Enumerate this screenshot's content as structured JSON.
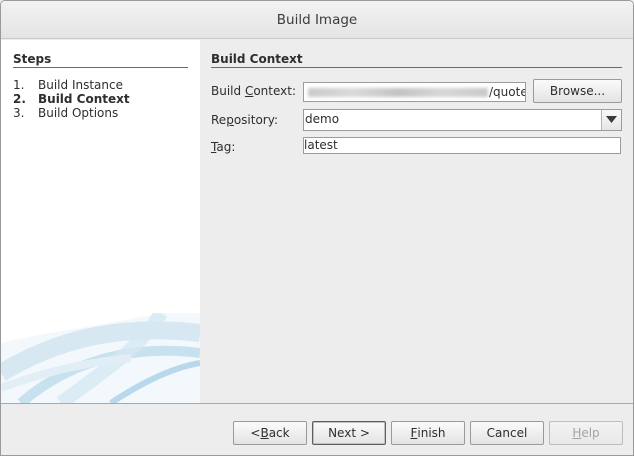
{
  "window": {
    "title": "Build Image"
  },
  "steps": {
    "heading": "Steps",
    "items": [
      {
        "num": "1.",
        "label": "Build Instance"
      },
      {
        "num": "2.",
        "label": "Build Context"
      },
      {
        "num": "3.",
        "label": "Build Options"
      }
    ],
    "current_index": 1
  },
  "content": {
    "heading": "Build Context",
    "build_context": {
      "label_prefix": "Build ",
      "label_mnemonic": "C",
      "label_suffix": "ontext:",
      "value_visible": "/quote",
      "browse_label": "Browse..."
    },
    "repository": {
      "label_prefix": "Re",
      "label_mnemonic": "p",
      "label_suffix": "ository:",
      "value": "demo"
    },
    "tag": {
      "label_mnemonic": "T",
      "label_suffix": "ag:",
      "value": "latest"
    }
  },
  "buttons": {
    "back_prefix": "< ",
    "back_mnemonic": "B",
    "back_suffix": "ack",
    "next": "Next >",
    "finish_mnemonic": "F",
    "finish_suffix": "inish",
    "cancel": "Cancel",
    "help_mnemonic": "H",
    "help_suffix": "elp"
  },
  "colors": {
    "accent_swoosh": "#a9cfe6",
    "panel_bg": "#ededed",
    "steps_bg": "#ffffff"
  }
}
